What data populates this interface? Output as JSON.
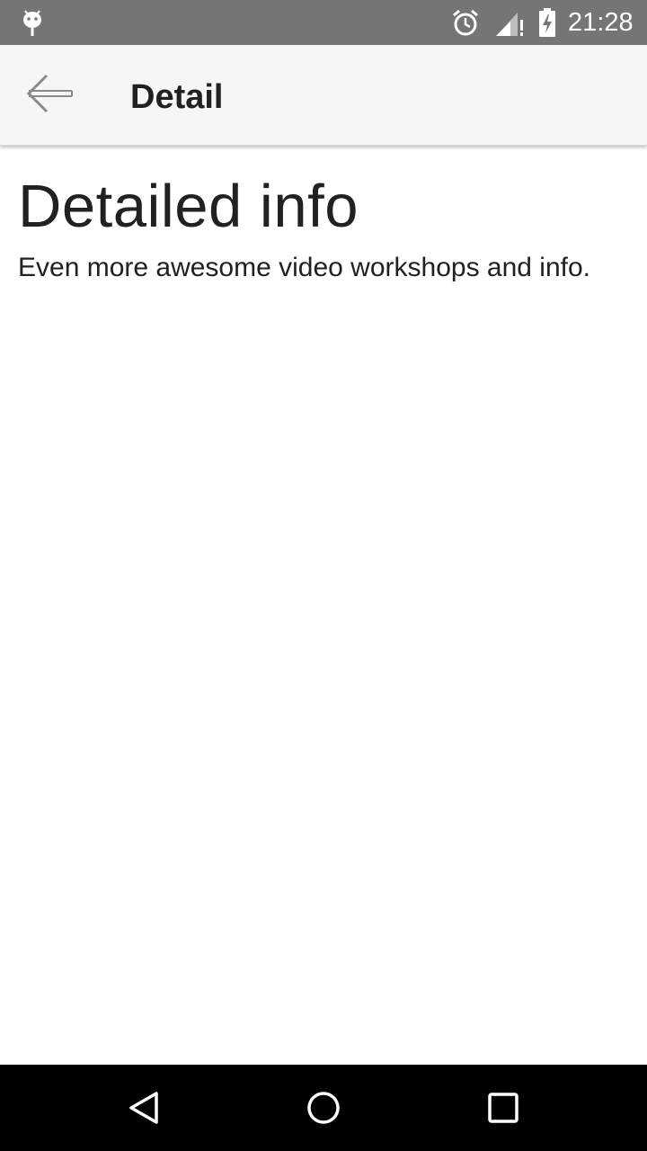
{
  "status_bar": {
    "time": "21:28",
    "icons": [
      "android-icon",
      "alarm-icon",
      "signal-icon",
      "battery-charging-icon"
    ]
  },
  "app_bar": {
    "title": "Detail",
    "back_icon": "arrow-back-icon"
  },
  "content": {
    "heading": "Detailed info",
    "body": "Even more awesome video workshops and info."
  },
  "nav_bar": {
    "icons": [
      "back-triangle-icon",
      "home-circle-icon",
      "recents-square-icon"
    ]
  },
  "colors": {
    "status_bar_bg": "#757575",
    "app_bar_bg": "#f6f6f6",
    "text": "#212121",
    "nav_bar_bg": "#000000"
  }
}
